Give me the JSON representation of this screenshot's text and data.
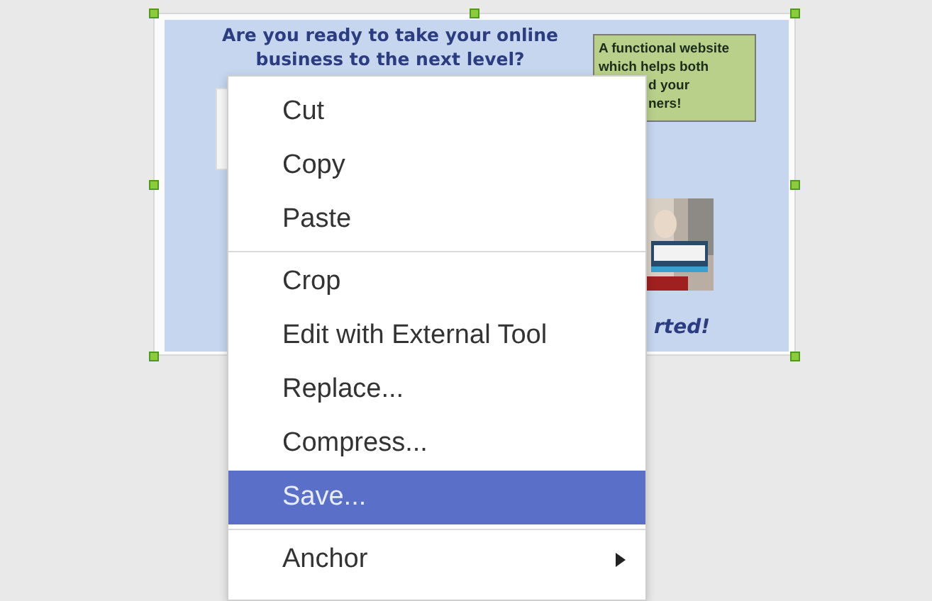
{
  "slide": {
    "heading_lines": [
      "Are you ready to take your online",
      "business to the next level?"
    ],
    "note": {
      "lines": [
        {
          "text": "A functional website",
          "kind": "full"
        },
        {
          "text": "which helps both",
          "kind": "full"
        },
        {
          "text": "d your",
          "kind": "cut"
        },
        {
          "text": "ners!",
          "kind": "cut"
        }
      ]
    },
    "tagline": "rted!"
  },
  "context_menu": {
    "items": [
      {
        "kind": "item",
        "label": "Cut",
        "selected": false
      },
      {
        "kind": "item",
        "label": "Copy",
        "selected": false
      },
      {
        "kind": "item",
        "label": "Paste",
        "selected": false
      },
      {
        "kind": "separator"
      },
      {
        "kind": "item",
        "label": "Crop",
        "selected": false
      },
      {
        "kind": "item",
        "label": "Edit with External Tool",
        "selected": false
      },
      {
        "kind": "item",
        "label": "Replace...",
        "selected": false
      },
      {
        "kind": "item",
        "label": "Compress...",
        "selected": false
      },
      {
        "kind": "item",
        "label": "Save...",
        "selected": true
      },
      {
        "kind": "separator"
      },
      {
        "kind": "submenu",
        "label": "Anchor",
        "selected": false
      }
    ]
  }
}
